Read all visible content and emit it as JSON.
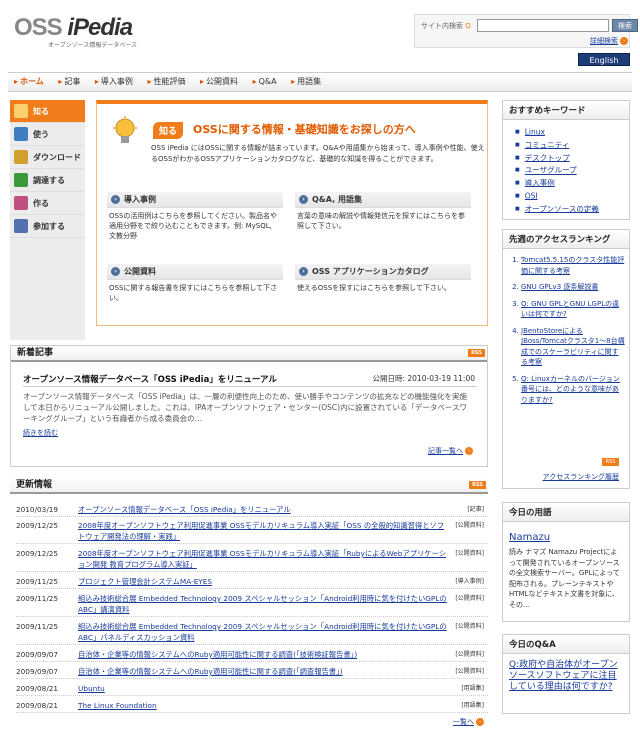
{
  "header": {
    "logo_main": "OSS",
    "logo_italic": "iPedia",
    "logo_sub": "オープンソース情報データベース",
    "search_label": "サイト内検索",
    "search_value": "",
    "search_button": "検索",
    "advanced_search": "詳細検索",
    "english_button": "English"
  },
  "globalnav": [
    "ホーム",
    "記事",
    "導入事例",
    "性能評価",
    "公開資料",
    "Q&A",
    "用語集"
  ],
  "leftnav": [
    {
      "label": "知る",
      "color": "#f0a040"
    },
    {
      "label": "使う",
      "color": "#3d7fc0"
    },
    {
      "label": "ダウンロード",
      "color": "#d0a030"
    },
    {
      "label": "調達する",
      "color": "#3a9a3a"
    },
    {
      "label": "作る",
      "color": "#c05080"
    },
    {
      "label": "参加する",
      "color": "#5070b0"
    }
  ],
  "intro": {
    "tag": "知る",
    "title": "OSSに関する情報・基礎知識をお探しの方へ",
    "text": "OSS iPedia にはOSSに関する情報が詰まっています。Q&Aや用語集から始まって、導入事例や性能、使えるOSSがわかるOSSアプリケーションカタログなど、基礎的な知識を得ることができます。",
    "boxes": [
      {
        "title": "導入事例",
        "text": "OSSの活用例はこちらを参照してください。製品名や適用分野をで絞り込むこともできます。例: MySQL, 文教分野"
      },
      {
        "title": "Q&A, 用語集",
        "text": "言葉の意味の解説や情報発信元を探すにはこちらを参照して下さい。"
      },
      {
        "title": "公開資料",
        "text": "OSSに関する報告書を探すにはこちらを参照して下さい。"
      },
      {
        "title": "OSS アプリケーションカタログ",
        "text": "使えるOSSを探すにはこちらを参照して下さい。"
      }
    ]
  },
  "news": {
    "heading": "新着記事",
    "rss": "RSS",
    "title": "オープンソース情報データベース「OSS iPedia」をリニューアル",
    "date": "公開日時: 2010-03-19 11:00",
    "body": "オープンソース情報データベース「OSS iPedia」は、一層の利便性向上のため、使い勝手やコンテンツの拡充などの機能強化を実施して本日からリニューアル公開しました。これは、IPAオープンソフトウェア・センター(OSC)内に設置されている「データベースワーキンググループ」という有識者から成る委員会の…",
    "more": "続きを読む",
    "list_link": "記事一覧へ"
  },
  "updates": {
    "heading": "更新情報",
    "rss": "RSS",
    "rows": [
      {
        "date": "2010/03/19",
        "title": "オープンソース情報データベース「OSS iPedia」をリニューアル",
        "cat": "[記事]"
      },
      {
        "date": "2009/12/25",
        "title": "2008年度オープンソフトウェア利用促進事業 OSSモデルカリキュラム導入実証「OSS の全般的知識習得とソフトウェア開発法の理解・実践」",
        "cat": "[公開資料]"
      },
      {
        "date": "2009/12/25",
        "title": "2008年度オープンソフトウェア利用促進事業 OSSモデルカリキュラム導入実証「RubyによるWebアプリケーション開発 教育プログラム導入実証」",
        "cat": "[公開資料]"
      },
      {
        "date": "2009/11/25",
        "title": "プロジェクト管理会計システムMA-EYES",
        "cat": "[導入事例]"
      },
      {
        "date": "2009/11/25",
        "title": "組込み技術総合展 Embedded Technology 2009 スペシャルセッション「Android利用時に気を付けたいGPLのABC」講演資料",
        "cat": "[公開資料]"
      },
      {
        "date": "2009/11/25",
        "title": "組込み技術総合展 Embedded Technology 2009 スペシャルセッション「Android利用時に気を付けたいGPLのABC」パネルディスカッション資料",
        "cat": "[公開資料]"
      },
      {
        "date": "2009/09/07",
        "title": "自治体・企業等の情報システムへのRuby適用可能性に関する調査(「技術検証報告書」)",
        "cat": "[公開資料]"
      },
      {
        "date": "2009/09/07",
        "title": "自治体・企業等の情報システムへのRuby適用可能性に関する調査(「調査報告書」)",
        "cat": "[公開資料]"
      },
      {
        "date": "2009/08/21",
        "title": "Ubuntu",
        "cat": "[用語集]"
      },
      {
        "date": "2009/08/21",
        "title": "The Linux Foundation",
        "cat": "[用語集]"
      }
    ],
    "more": "一覧へ"
  },
  "keywords": {
    "heading": "おすすめキーワード",
    "items": [
      "Linux",
      "コミュニティ",
      "デスクトップ",
      "ユーザグループ",
      "導入事例",
      "OSI",
      "オープンソースの定義"
    ]
  },
  "ranking": {
    "heading": "先週のアクセスランキング",
    "items": [
      "Tomcat5.5.15のクラスタ性能評価に関する考察",
      "GNU GPLv3 逐条解説書",
      "Q: GNU GPLとGNU LGPLの違いは何ですか?",
      "JBentoStoreによるJBoss/Tomcatクラスタ1〜8台構成でのスケーラビリティに関する考察",
      "Q: Linuxカーネルのバージョン番号には、どのような意味がありますか?"
    ],
    "rss": "RSS",
    "more": "アクセスランキング履歴"
  },
  "term": {
    "heading": "今日の用語",
    "title": "Namazu",
    "text": "読み ナマズ Namazu Projectによって開発されているオープンソースの全文検索サーバー。GPLによって配布される。プレーンテキストやHTMLなどテキスト文書を対象に、その…"
  },
  "qa": {
    "heading": "今日のQ&A",
    "question": "Q:政府や自治体がオープンソースソフトウェアに注目している理由は何ですか?"
  }
}
